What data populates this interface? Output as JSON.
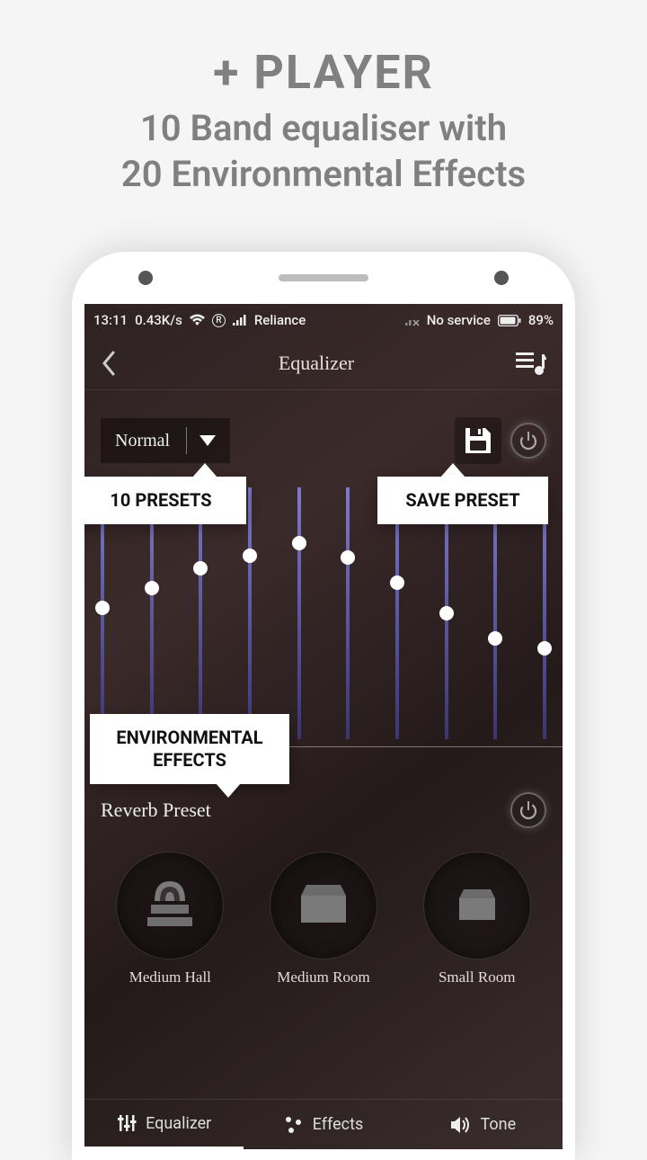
{
  "promo": {
    "title": "+ PLAYER",
    "line1": "10 Band equaliser with",
    "line2": "20 Environmental Effects"
  },
  "status": {
    "time": "13:11",
    "speed": "0.43K/s",
    "carrier": "Reliance",
    "service": "No service",
    "battery": "89%"
  },
  "header": {
    "title": "Equalizer"
  },
  "preset": {
    "selected": "Normal"
  },
  "callouts": {
    "presets": "10 PRESETS",
    "save": "SAVE PRESET",
    "env": "ENVIRONMENTAL EFFECTS"
  },
  "eq_bands": [
    52,
    60,
    68,
    73,
    78,
    72,
    62,
    50,
    40,
    36
  ],
  "reverb": {
    "title": "Reverb Preset",
    "options": [
      "Medium Hall",
      "Medium Room",
      "Small Room"
    ]
  },
  "tabs": {
    "equalizer": "Equalizer",
    "effects": "Effects",
    "tone": "Tone"
  }
}
